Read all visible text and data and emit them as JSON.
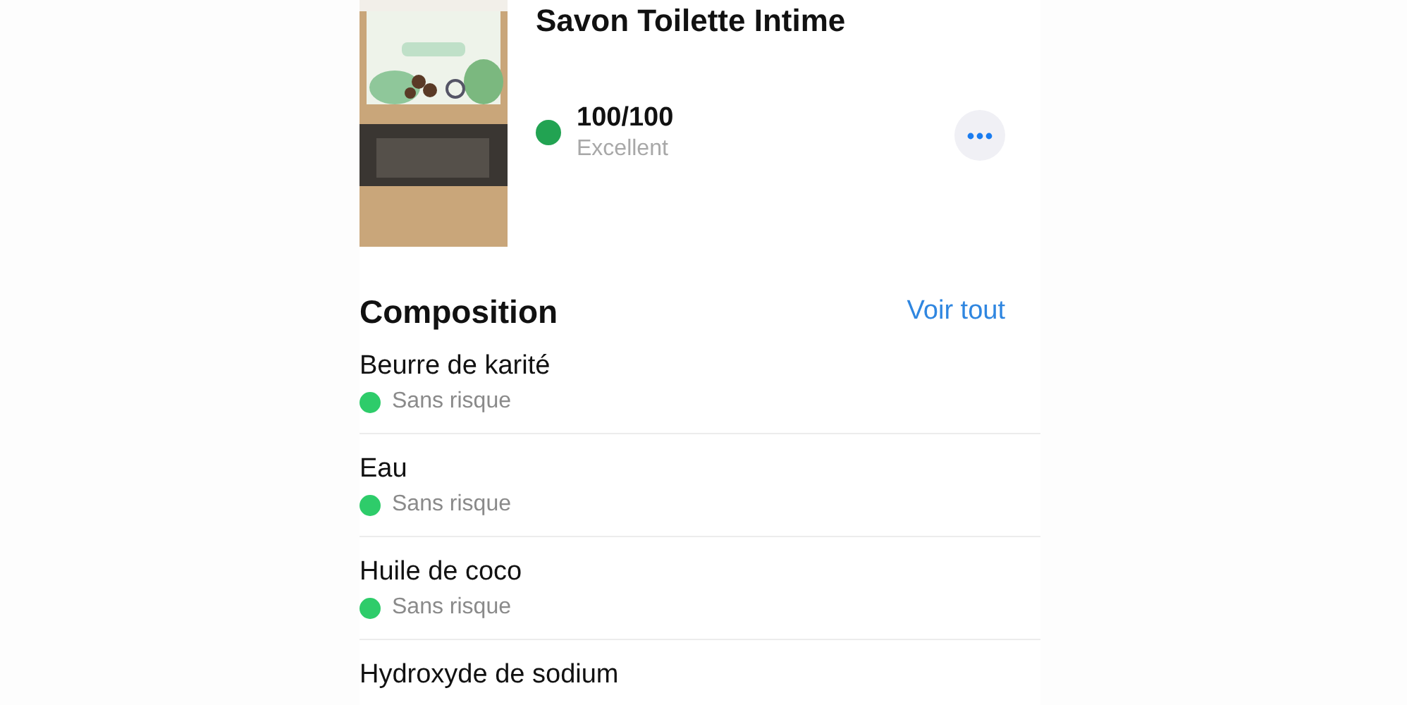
{
  "product": {
    "title": "Savon Toilette Intime",
    "score": {
      "value": "100/100",
      "rating": "Excellent",
      "color": "#22a352"
    }
  },
  "composition": {
    "title": "Composition",
    "link": "Voir tout",
    "ingredients": [
      {
        "name": "Beurre de karité",
        "risk": "Sans risque",
        "color": "#2ecc6a"
      },
      {
        "name": "Eau",
        "risk": "Sans risque",
        "color": "#2ecc6a"
      },
      {
        "name": "Huile de coco",
        "risk": "Sans risque",
        "color": "#2ecc6a"
      },
      {
        "name": "Hydroxyde de sodium"
      }
    ]
  }
}
